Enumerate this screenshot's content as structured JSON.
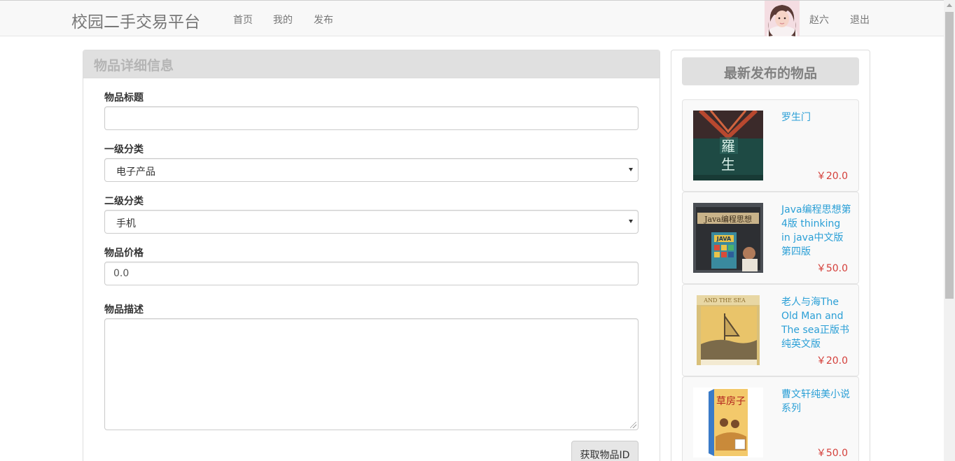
{
  "navbar": {
    "brand": "校园二手交易平台",
    "links": [
      {
        "label": "首页"
      },
      {
        "label": "我的"
      },
      {
        "label": "发布"
      }
    ],
    "user": {
      "name": "赵六",
      "logout": "退出"
    }
  },
  "form": {
    "panel_title": "物品详细信息",
    "title_label": "物品标题",
    "title_value": "",
    "category1_label": "一级分类",
    "category1_value": "电子产品",
    "category2_label": "二级分类",
    "category2_value": "手机",
    "price_label": "物品价格",
    "price_value": "0.0",
    "description_label": "物品描述",
    "description_value": "",
    "get_id_button": "获取物品ID"
  },
  "sidebar": {
    "title": "最新发布的物品",
    "items": [
      {
        "title": "罗生门",
        "price": "￥20.0",
        "thumb": "rashomon-book-cover"
      },
      {
        "title": "Java编程思想第4版 thinking in java中文版第四版",
        "price": "￥50.0",
        "thumb": "thinking-in-java-cover"
      },
      {
        "title": "老人与海The Old Man and The sea正版书纯英文版",
        "price": "￥20.0",
        "thumb": "old-man-and-the-sea-cover"
      },
      {
        "title": "曹文轩纯美小说系列",
        "price": "￥50.0",
        "thumb": "cao-wenxuan-book-cover"
      }
    ]
  }
}
